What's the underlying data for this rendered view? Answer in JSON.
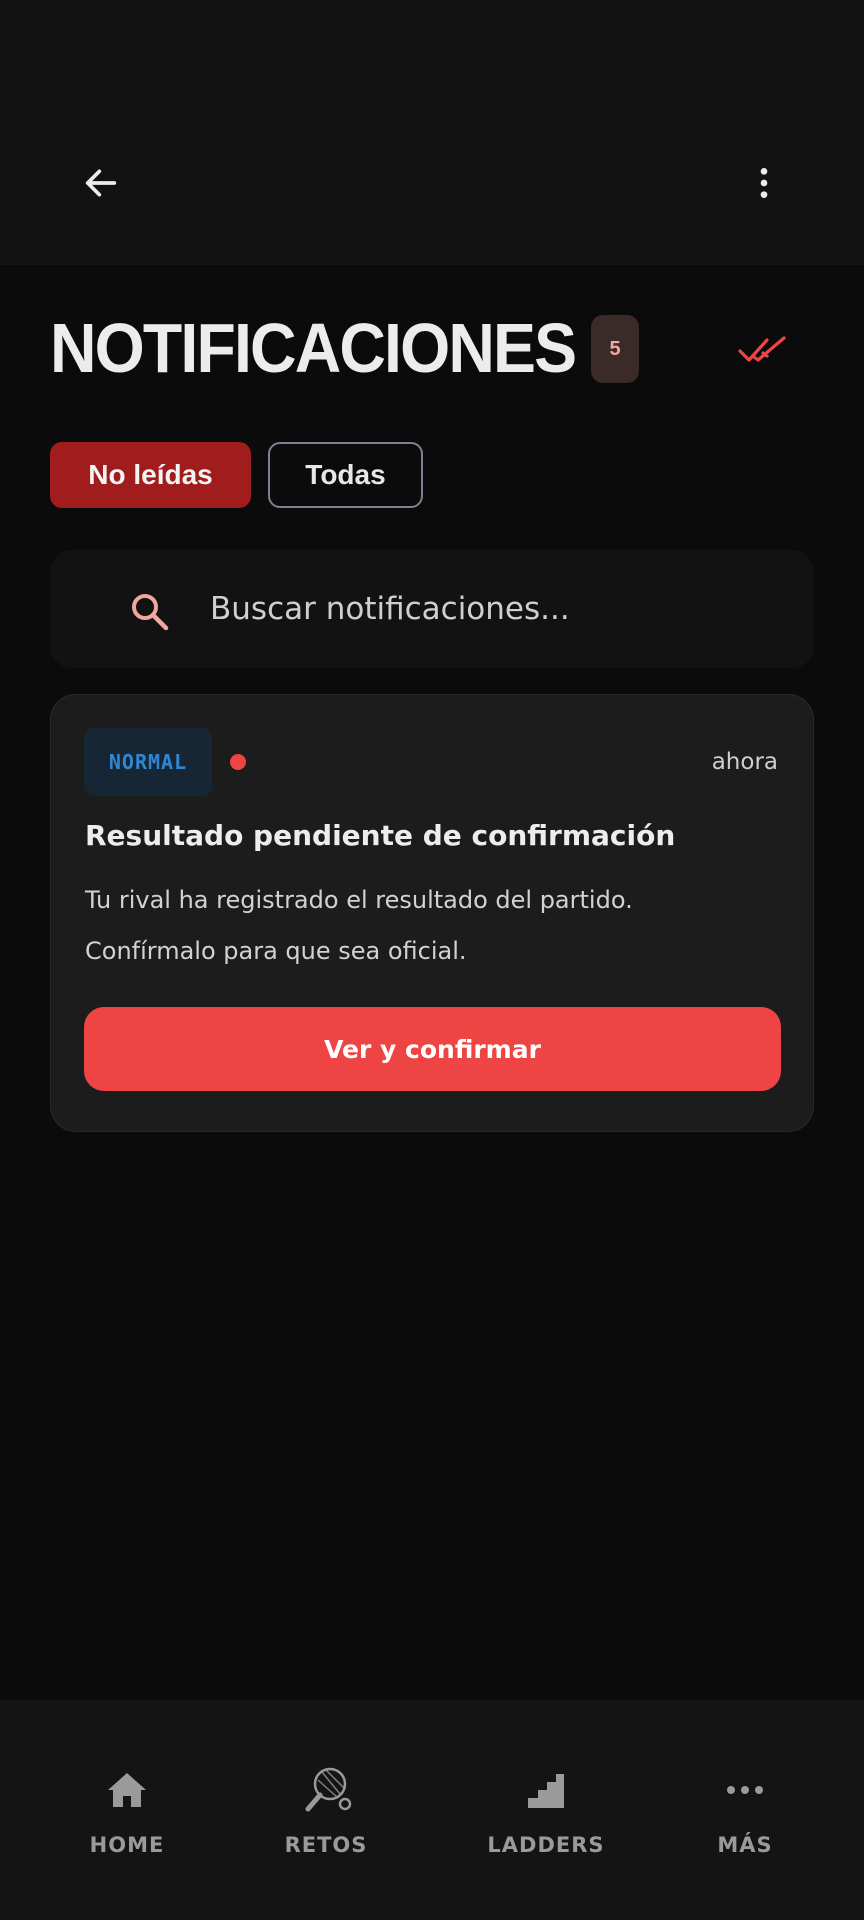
{
  "appbar": {
    "back_icon": "arrow-left-icon",
    "more_icon": "more-vertical-icon"
  },
  "header": {
    "title": "NOTIFICACIONES",
    "unread_count": "5",
    "mark_all_icon": "double-check-icon"
  },
  "tabs": [
    {
      "label": "No leídas",
      "active": true
    },
    {
      "label": "Todas",
      "active": false
    }
  ],
  "search": {
    "icon": "search-icon",
    "placeholder": "Buscar notificaciones..."
  },
  "notifications": [
    {
      "priority": "NORMAL",
      "unread": true,
      "time": "ahora",
      "title": "Resultado pendiente de confirmación",
      "body_line1": "Tu rival ha registrado el resultado del partido.",
      "body_line2": "Confírmalo para que sea oficial.",
      "action_label": "Ver y confirmar"
    }
  ],
  "nav": {
    "items": [
      {
        "label": "HOME",
        "icon": "home-icon"
      },
      {
        "label": "RETOS",
        "icon": "racket-icon"
      },
      {
        "label": "LADDERS",
        "icon": "stairs-icon"
      },
      {
        "label": "MÁS",
        "icon": "more-horizontal-icon"
      }
    ]
  },
  "colors": {
    "accent": "#ee4444",
    "tab_active": "#a11d1d",
    "badge_blue": "#2f86d6",
    "background": "#0b0b0b"
  }
}
